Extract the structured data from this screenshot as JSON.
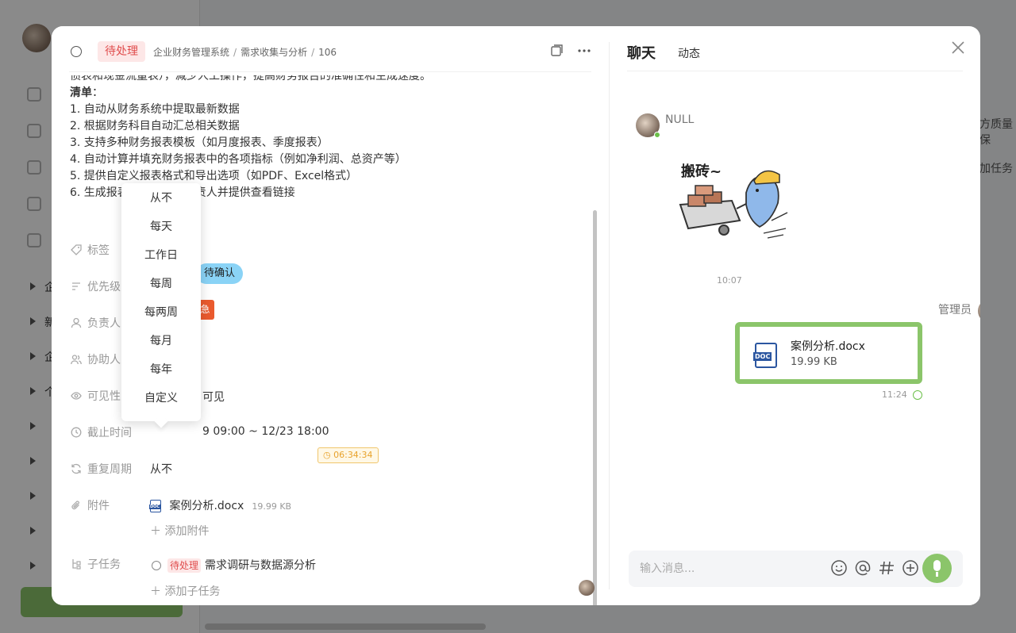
{
  "background": {
    "sidebar_rows": [
      "企",
      "新",
      "企",
      "个",
      "",
      "",
      "",
      "",
      ""
    ],
    "right_snippets": [
      "方质量保",
      "加任务"
    ]
  },
  "header": {
    "status": "待处理",
    "breadcrumb": [
      "企业财务管理系统",
      "需求收集与分析",
      "106"
    ],
    "copy_icon": "copy-icon",
    "more_icon": "more-icon"
  },
  "description": {
    "cut_line": "债表和现金流量表），减少人工操作，提高财务报告的准确性和生成速度。",
    "list_title": "清单",
    "list_colon": "：",
    "items": [
      "1. 自动从财务系统中提取最新数据",
      "2. 根据财务科目自动汇总相关数据",
      "3. 支持多种财务报表模板（如月度报表、季度报表）",
      "4. 自动计算并填充财务报表中的各项指标（例如净利润、总资产等）",
      "5. 提供自定义报表格式和导出选项（如PDF、Excel格式）",
      "6. 生成报表后自动通知负责人并提供查看链接"
    ]
  },
  "props": {
    "tags_label": "标签",
    "tag_value": "待确认",
    "priority_label": "优先级",
    "priority_value": "急",
    "owner_label": "负责人",
    "assist_label": "协助人员",
    "visibility_label": "可见性",
    "visibility_value": "可见",
    "deadline_label": "截止时间",
    "deadline_value": "9 09:00 ~ 12/23 18:00",
    "timer_value": "06:34:34",
    "repeat_label": "重复周期",
    "repeat_value": "从不",
    "attach_label": "附件",
    "attach_name": "案例分析.docx",
    "attach_size": "19.99 KB",
    "add_attach": "添加附件",
    "subtask_label": "子任务",
    "subtask_status": "待处理",
    "subtask_name": "需求调研与数据源分析",
    "add_subtask": "添加子任务"
  },
  "repeat_dropdown": {
    "options": [
      "从不",
      "每天",
      "工作日",
      "每周",
      "每两周",
      "每月",
      "每年",
      "自定义"
    ]
  },
  "chat": {
    "title": "聊天",
    "tab": "动态",
    "msg1_sender": "NULL",
    "sticker_text": "搬砖~",
    "msg1_time": "10:07",
    "msg2_sender": "管理员",
    "file_name": "案例分析.docx",
    "file_size": "19.99 KB",
    "msg2_time": "11:24",
    "input_placeholder": "输入消息..."
  },
  "colors": {
    "accent_green": "#8bc56a",
    "status_red": "#e04d4d",
    "tag_blue": "#8ad3f6",
    "priority_orange": "#ea5a2e"
  }
}
